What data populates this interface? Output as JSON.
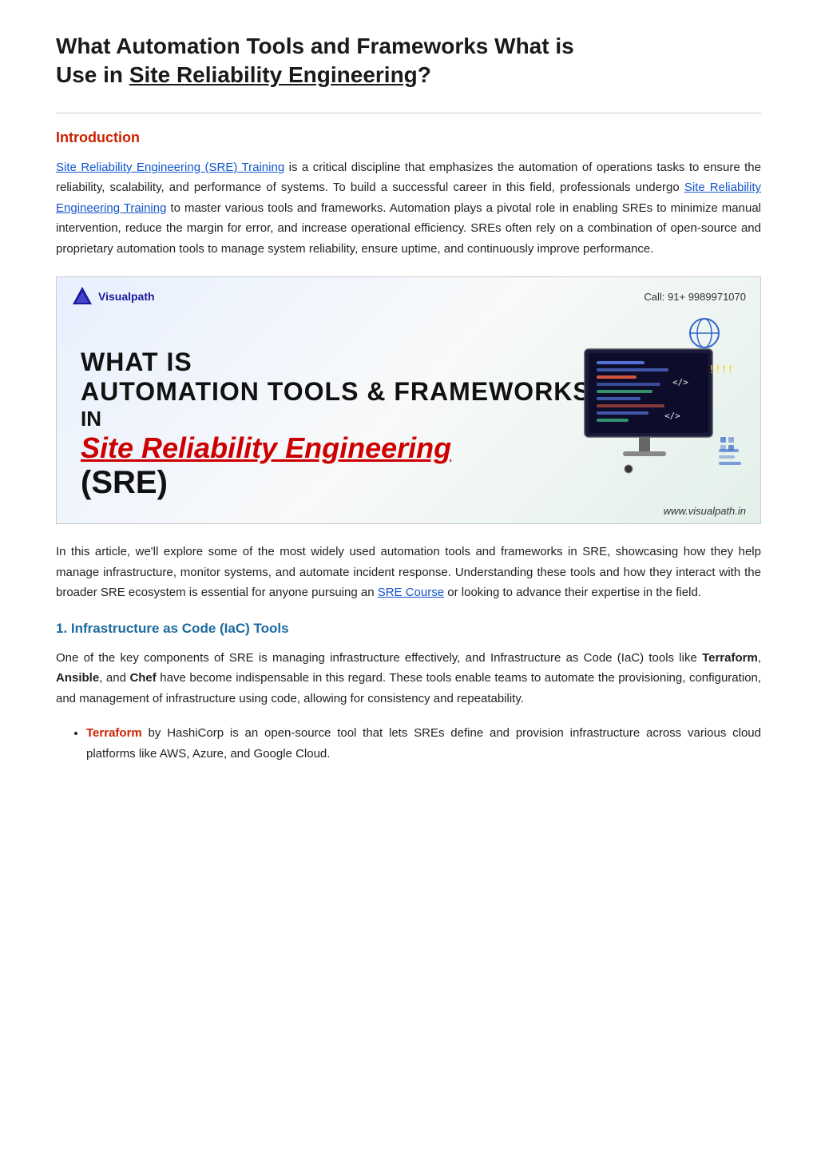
{
  "page": {
    "title_part1": "What  Automation  Tools  and  Frameworks  What  is",
    "title_part2": "Use in ",
    "title_link": "Site Reliability Engineering",
    "title_end": "?",
    "intro_heading": "Introduction",
    "intro_para1_link1": "Site Reliability Engineering (SRE) Training",
    "intro_para1_text1": " is a critical discipline that emphasizes the automation of operations tasks to ensure the reliability, scalability, and performance of systems. To build a successful career in this field, professionals undergo ",
    "intro_para1_link2": "Site Reliability Engineering Training",
    "intro_para1_text2": " to master various tools and frameworks. Automation plays a pivotal role in enabling SREs to minimize manual intervention, reduce the margin for error, and increase operational efficiency. SREs often rely on a combination of open-source and proprietary automation tools to manage system reliability, ensure uptime, and continuously improve performance.",
    "banner": {
      "logo_text": "Visualpath",
      "phone": "Call: 91+ 9989971070",
      "title_line1": "WHAT IS",
      "title_line2": "AUTOMATION TOOLS & FRAMEWORKS",
      "title_line3": "IN",
      "title_line4": "Site Reliability Engineering",
      "title_line5": "(SRE)",
      "website": "www.visualpath.in"
    },
    "article_para1": "In this article, we'll explore some of the most widely used automation tools and frameworks in SRE, showcasing how they help manage infrastructure, monitor systems, and automate incident response. Understanding these tools and how they interact with the broader SRE ecosystem is essential for anyone pursuing an ",
    "article_para1_link": "SRE Course",
    "article_para1_end": " or looking to advance their expertise in the field.",
    "section1_heading": "1. Infrastructure as Code (IaC) Tools",
    "section1_para1": "One of the key components of SRE is managing infrastructure effectively, and Infrastructure as Code (IaC) tools like ",
    "section1_term1": "Terraform",
    "section1_para1b": ", ",
    "section1_term2": "Ansible",
    "section1_para1c": ", and ",
    "section1_term3": "Chef",
    "section1_para1d": " have become indispensable in this regard. These tools enable teams to automate the provisioning, configuration, and management of infrastructure using code, allowing for consistency and repeatability.",
    "bullet1_term": "Terraform",
    "bullet1_text": " by HashiCorp is an open-source tool that lets SREs define and provision infrastructure across various cloud platforms like AWS, Azure, and Google Cloud."
  }
}
